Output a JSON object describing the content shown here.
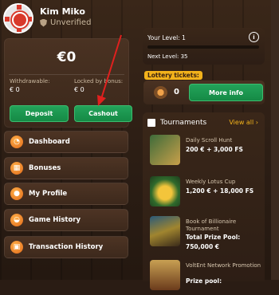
{
  "user": {
    "name": "Kim Miko",
    "status": "Unverified"
  },
  "balance": {
    "amount": "€0",
    "withdrawable_label": "Withdrawable:",
    "withdrawable_value": "€ 0",
    "locked_label": "Locked by bonus:",
    "locked_value": "€ 0",
    "deposit_label": "Deposit",
    "cashout_label": "Cashout"
  },
  "menu": [
    {
      "label": "Dashboard",
      "icon": "dashboard-icon",
      "glyph": "◔"
    },
    {
      "label": "Bonuses",
      "icon": "gift-icon",
      "glyph": "▦"
    },
    {
      "label": "My Profile",
      "icon": "profile-icon",
      "glyph": "●"
    },
    {
      "label": "Game History",
      "icon": "game-history-icon",
      "glyph": "◒"
    },
    {
      "label": "Transaction History",
      "icon": "transaction-history-icon",
      "glyph": "▣"
    }
  ],
  "level": {
    "current": "Your Level: 1",
    "next": "Next Level: 35",
    "progress": 0.0
  },
  "lottery": {
    "label": "Lottery tickets:",
    "count": "0",
    "more_info": "More info"
  },
  "tournaments": {
    "title": "Tournaments",
    "view_all": "View all",
    "items": [
      {
        "name": "Daily Scroll Hunt",
        "prize": "200 € + 3,000 FS",
        "sub": ""
      },
      {
        "name": "Weekly Lotus Cup",
        "prize": "1,200 € + 18,000 FS",
        "sub": ""
      },
      {
        "name": "Book of Billionaire Tournament",
        "prize": "Total Prize Pool:",
        "sub": "750,000 €"
      },
      {
        "name": "VoltEnt Network Promotion",
        "prize": "Prize pool:",
        "sub": ""
      }
    ]
  },
  "colors": {
    "accent_green": "#1d9a50",
    "gold": "#f2b21b",
    "arrow_red": "#e0201e"
  }
}
